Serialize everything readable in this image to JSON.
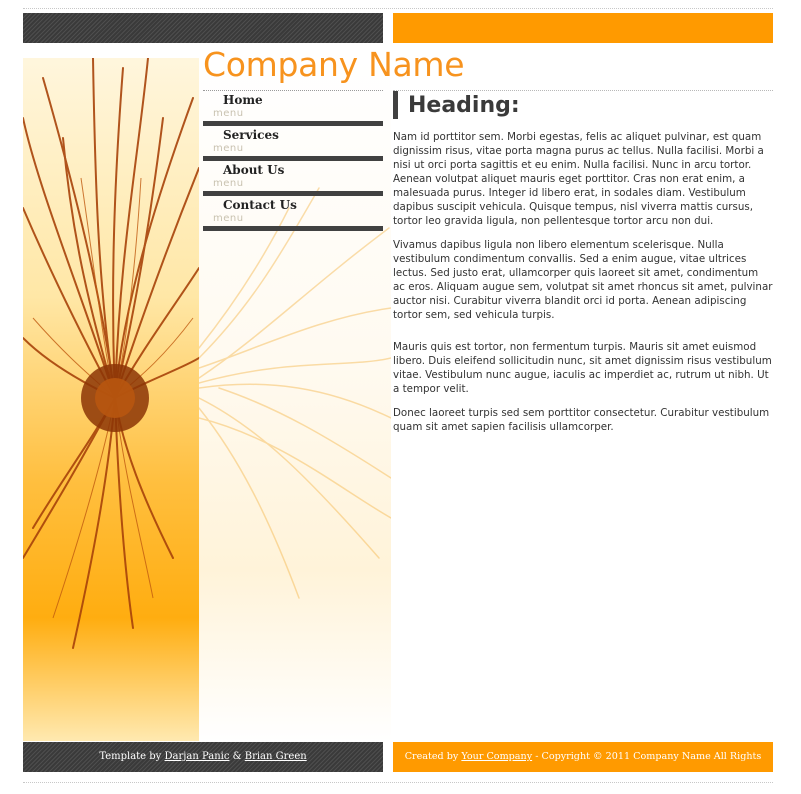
{
  "header": {
    "company_name": "Company Name"
  },
  "nav": {
    "items": [
      {
        "label": "Home",
        "sub": "menu"
      },
      {
        "label": "Services",
        "sub": "menu"
      },
      {
        "label": "About Us",
        "sub": "menu"
      },
      {
        "label": "Contact Us",
        "sub": "menu"
      }
    ]
  },
  "content": {
    "heading": "Heading:",
    "paragraphs": [
      "Nam id porttitor sem. Morbi egestas, felis ac aliquet pulvinar, est quam dignissim risus, vitae porta magna purus ac tellus. Nulla facilisi. Morbi a nisi ut orci porta sagittis et eu enim. Nulla facilisi. Nunc in arcu tortor. Aenean volutpat aliquet mauris eget porttitor. Cras non erat enim, a malesuada purus. Integer id libero erat, in sodales diam. Vestibulum dapibus suscipit vehicula. Quisque tempus, nisl viverra mattis cursus, tortor leo gravida ligula, non pellentesque tortor arcu non dui.",
      "Vivamus dapibus ligula non libero elementum scelerisque. Nulla vestibulum condimentum convallis. Sed a enim augue, vitae ultrices lectus. Sed justo erat, ullamcorper quis laoreet sit amet, condimentum ac eros. Aliquam augue sem, volutpat sit amet rhoncus sit amet, pulvinar auctor nisi. Curabitur viverra blandit orci id porta. Aenean adipiscing tortor sem, sed vehicula turpis.",
      "Mauris quis est tortor, non fermentum turpis. Mauris sit amet euismod libero. Duis eleifend sollicitudin nunc, sit amet dignissim risus vestibulum vitae. Vestibulum nunc augue, iaculis ac imperdiet ac, rutrum ut nibh. Ut a tempor velit.",
      "Donec laoreet turpis sed sem porttitor consectetur. Curabitur vestibulum quam sit amet sapien facilisis ullamcorper."
    ]
  },
  "footer": {
    "left": {
      "prefix": "Template by",
      "author1": "Darjan Panic",
      "amp": "&",
      "author2": "Brian Green"
    },
    "right": {
      "prefix": "Created by",
      "link": "Your Company",
      "suffix": "- Copyright © 2011 Company Name All Rights"
    }
  },
  "colors": {
    "accent": "#ff9a00",
    "brand_text": "#f7931e",
    "dark": "#414141"
  },
  "icons": {
    "artwork": "orange-sea-anemone-artwork"
  }
}
